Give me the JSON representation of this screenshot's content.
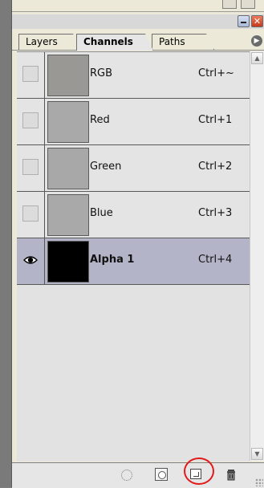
{
  "panel": {
    "close_glyph": "✕",
    "tabs": [
      {
        "label": "Layers",
        "active": false
      },
      {
        "label": "Channels",
        "active": true
      },
      {
        "label": "Paths",
        "active": false
      }
    ],
    "menu_arrow_glyph": "▶"
  },
  "channels": [
    {
      "name": "RGB",
      "shortcut": "Ctrl+~",
      "thumb_color": "#9a9895",
      "visible": false,
      "selected": false
    },
    {
      "name": "Red",
      "shortcut": "Ctrl+1",
      "thumb_color": "#a9a9a9",
      "visible": false,
      "selected": false
    },
    {
      "name": "Green",
      "shortcut": "Ctrl+2",
      "thumb_color": "#a8a8a8",
      "visible": false,
      "selected": false
    },
    {
      "name": "Blue",
      "shortcut": "Ctrl+3",
      "thumb_color": "#a9a9a9",
      "visible": false,
      "selected": false
    },
    {
      "name": "Alpha 1",
      "shortcut": "Ctrl+4",
      "thumb_color": "#000000",
      "visible": true,
      "selected": true
    }
  ],
  "footer": {
    "icons": [
      "load-selection-icon",
      "save-selection-icon",
      "new-channel-icon",
      "delete-channel-icon"
    ],
    "highlight_color": "#e21a1a"
  }
}
